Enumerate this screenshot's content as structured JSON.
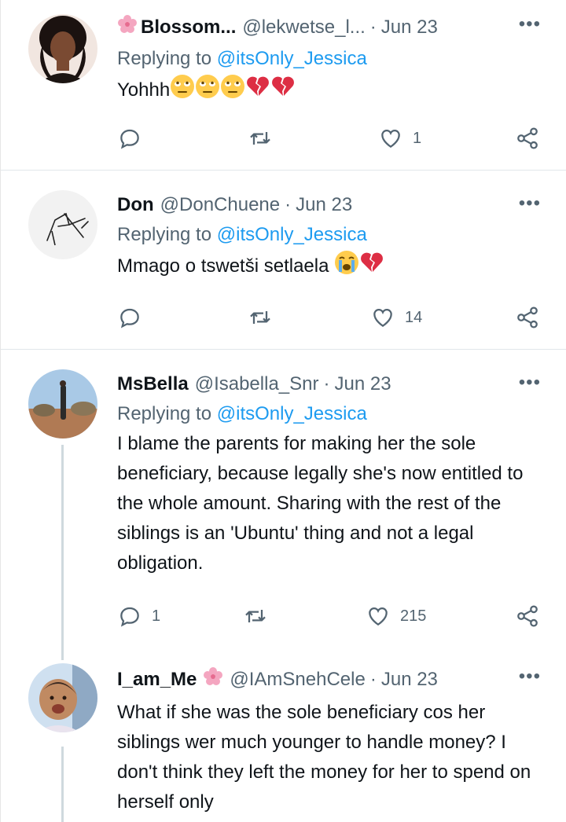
{
  "replies": [
    {
      "name": "Blossom...",
      "handle": "@lekwetse_l...",
      "sep": "·",
      "date": "Jun 23",
      "replying_prefix": "Replying to",
      "replying_to": "@itsOnly_Jessica",
      "text": "Yohhh",
      "emojis": [
        "rolling-eyes-face",
        "rolling-eyes-face",
        "rolling-eyes-face",
        "broken-heart",
        "broken-heart"
      ],
      "counts": {
        "reply": "",
        "retweet": "",
        "like": "1"
      }
    },
    {
      "name": "Don",
      "handle": "@DonChuene",
      "sep": "·",
      "date": "Jun 23",
      "replying_prefix": "Replying to",
      "replying_to": "@itsOnly_Jessica",
      "text": "Mmago o tswetši setlaela",
      "emojis": [
        "crying-face",
        "broken-heart"
      ],
      "counts": {
        "reply": "",
        "retweet": "",
        "like": "14"
      }
    },
    {
      "name": "MsBella",
      "handle": "@Isabella_Snr",
      "sep": "·",
      "date": "Jun 23",
      "replying_prefix": "Replying to",
      "replying_to": "@itsOnly_Jessica",
      "text": "I blame the parents for making her the sole beneficiary, because legally she's now entitled to the whole amount. Sharing with the rest of the siblings is an 'Ubuntu' thing and not a legal obligation.",
      "counts": {
        "reply": "1",
        "retweet": "",
        "like": "215"
      }
    },
    {
      "name": "I_am_Me",
      "handle": "@IAmSnehCele",
      "sep": "·",
      "date": "Jun 23",
      "text": "What if she was the sole beneficiary cos her siblings wer much younger to handle money? I don't think they left the money for her to spend on herself only"
    }
  ],
  "more_label": "•••",
  "colors": {
    "link": "#1d9bf0",
    "muted": "#536471",
    "text": "#0f1419",
    "heart": "#e0245e"
  }
}
